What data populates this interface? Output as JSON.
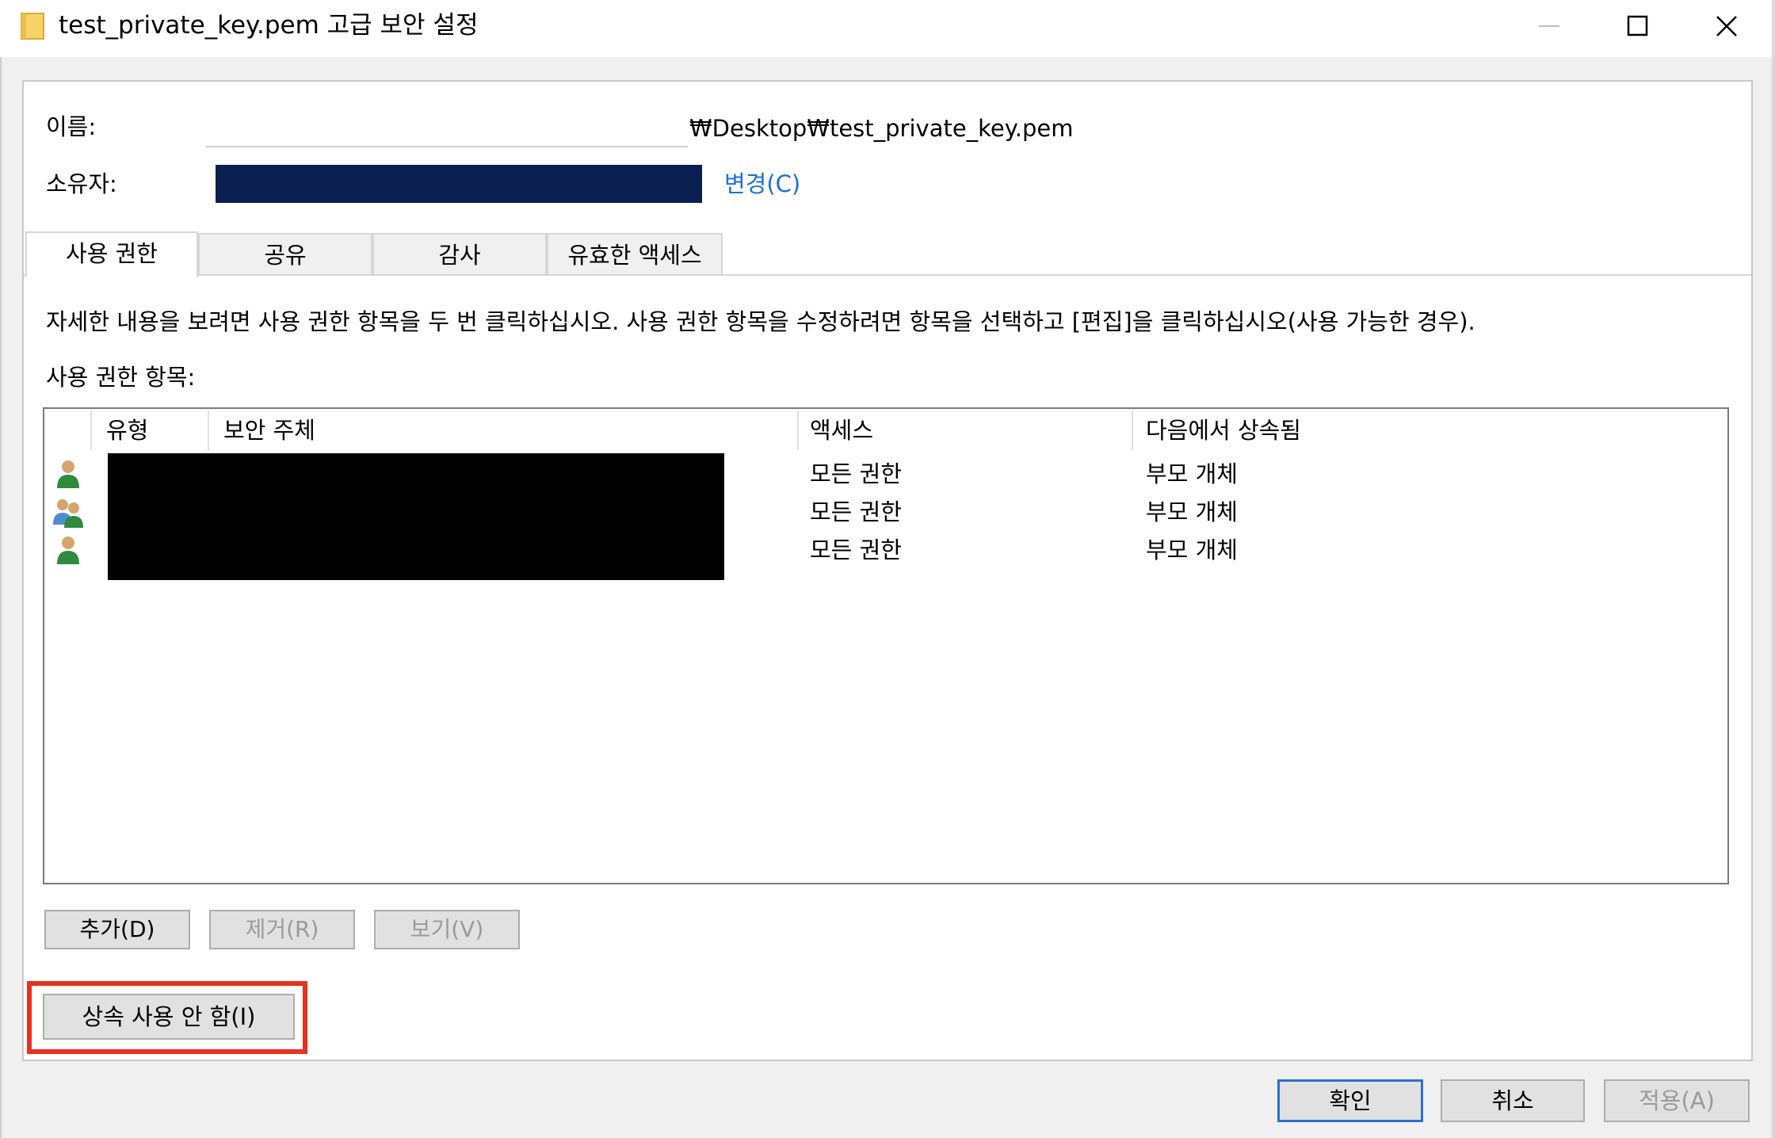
{
  "window": {
    "title": "test_private_key.pem 고급 보안 설정",
    "minimize_icon": "minimize-icon",
    "maximize_icon": "maximize-icon",
    "close_icon": "close-icon"
  },
  "header": {
    "name_label": "이름:",
    "name_path": "₩Desktop₩test_private_key.pem",
    "owner_label": "소유자:",
    "owner_change": "변경(C)"
  },
  "tabs": [
    {
      "label": "사용 권한",
      "selected": true
    },
    {
      "label": "공유"
    },
    {
      "label": "감사"
    },
    {
      "label": "유효한 액세스"
    }
  ],
  "info_text": "자세한 내용을 보려면 사용 권한 항목을 두 번 클릭하십시오. 사용 권한 항목을 수정하려면 항목을 선택하고 [편집]을 클릭하십시오(사용 가능한 경우).",
  "entries_label": "사용 권한 항목:",
  "columns": [
    "유형",
    "보안 주체",
    "액세스",
    "다음에서 상속됨"
  ],
  "rows": [
    {
      "icon": "user-icon",
      "access": "모든 권한",
      "inherited_from": "부모 개체"
    },
    {
      "icon": "group-icon",
      "access": "모든 권한",
      "inherited_from": "부모 개체"
    },
    {
      "icon": "user-icon",
      "access": "모든 권한",
      "inherited_from": "부모 개체"
    }
  ],
  "buttons": {
    "add": "추가(D)",
    "remove": "제거(R)",
    "view": "보기(V)",
    "disable_inheritance": "상속 사용 안 함(I)",
    "ok": "확인",
    "cancel": "취소",
    "apply": "적용(A)"
  },
  "colors": {
    "highlight": "#e8311e",
    "link": "#1a6fd8",
    "default_button_border": "#2a6fd4"
  }
}
